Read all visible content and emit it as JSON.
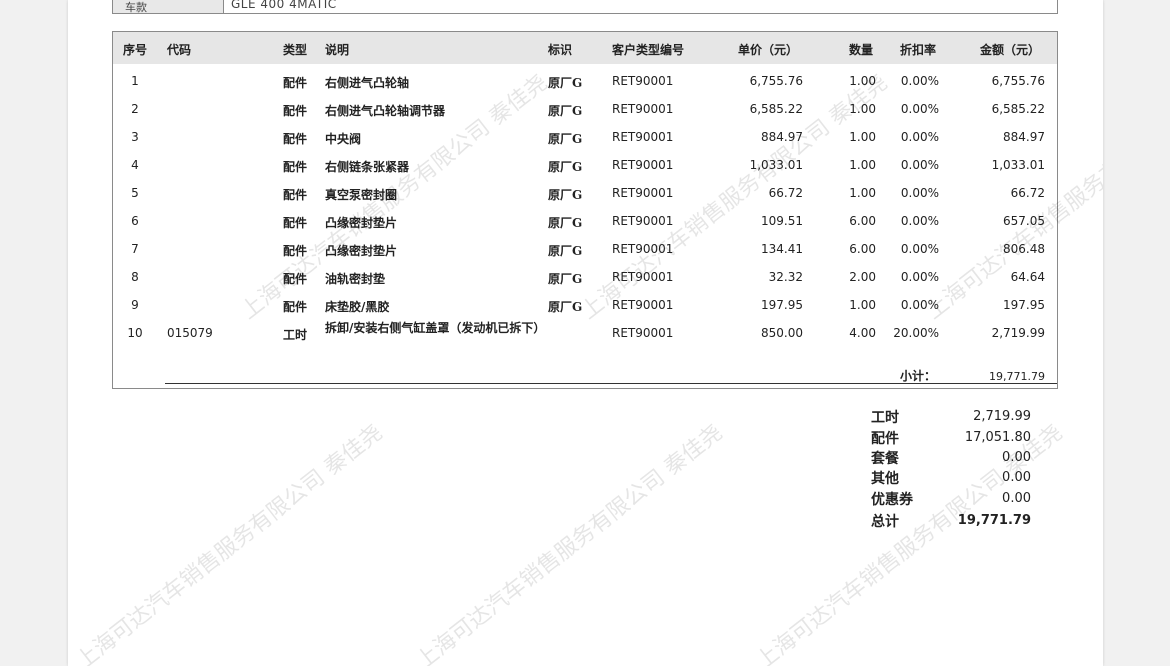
{
  "header_fragment": {
    "label": "车款",
    "value": "GLE 400 4MATIC"
  },
  "table": {
    "columns": [
      "序号",
      "代码",
      "类型",
      "说明",
      "标识",
      "客户类型编号",
      "单价（元）",
      "数量",
      "折扣率",
      "金额（元）"
    ],
    "rows": [
      {
        "no": "1",
        "code": "",
        "type": "配件",
        "desc": "右侧进气凸轮轴",
        "mark": "原厂G",
        "cust": "RET90001",
        "price": "6,755.76",
        "qty": "1.00",
        "disc": "0.00%",
        "amount": "6,755.76"
      },
      {
        "no": "2",
        "code": "",
        "type": "配件",
        "desc": "右侧进气凸轮轴调节器",
        "mark": "原厂G",
        "cust": "RET90001",
        "price": "6,585.22",
        "qty": "1.00",
        "disc": "0.00%",
        "amount": "6,585.22"
      },
      {
        "no": "3",
        "code": "",
        "type": "配件",
        "desc": "中央阀",
        "mark": "原厂G",
        "cust": "RET90001",
        "price": "884.97",
        "qty": "1.00",
        "disc": "0.00%",
        "amount": "884.97"
      },
      {
        "no": "4",
        "code": "",
        "type": "配件",
        "desc": "右侧链条张紧器",
        "mark": "原厂G",
        "cust": "RET90001",
        "price": "1,033.01",
        "qty": "1.00",
        "disc": "0.00%",
        "amount": "1,033.01"
      },
      {
        "no": "5",
        "code": "",
        "type": "配件",
        "desc": "真空泵密封圈",
        "mark": "原厂G",
        "cust": "RET90001",
        "price": "66.72",
        "qty": "1.00",
        "disc": "0.00%",
        "amount": "66.72"
      },
      {
        "no": "6",
        "code": "",
        "type": "配件",
        "desc": "凸缘密封垫片",
        "mark": "原厂G",
        "cust": "RET90001",
        "price": "109.51",
        "qty": "6.00",
        "disc": "0.00%",
        "amount": "657.05"
      },
      {
        "no": "7",
        "code": "",
        "type": "配件",
        "desc": "凸缘密封垫片",
        "mark": "原厂G",
        "cust": "RET90001",
        "price": "134.41",
        "qty": "6.00",
        "disc": "0.00%",
        "amount": "806.48"
      },
      {
        "no": "8",
        "code": "",
        "type": "配件",
        "desc": "油轨密封垫",
        "mark": "原厂G",
        "cust": "RET90001",
        "price": "32.32",
        "qty": "2.00",
        "disc": "0.00%",
        "amount": "64.64"
      },
      {
        "no": "9",
        "code": "",
        "type": "配件",
        "desc": "床垫胶/黑胶",
        "mark": "原厂G",
        "cust": "RET90001",
        "price": "197.95",
        "qty": "1.00",
        "disc": "0.00%",
        "amount": "197.95"
      },
      {
        "no": "10",
        "code": "015079",
        "type": "工时",
        "desc": "拆卸/安装右侧气缸盖罩（发动机已拆下）",
        "mark": "",
        "cust": "RET90001",
        "price": "850.00",
        "qty": "4.00",
        "disc": "20.00%",
        "amount": "2,719.99"
      }
    ],
    "subtotal_label": "小计：",
    "subtotal_value": "19,771.79"
  },
  "summary": {
    "labor_label": "工时",
    "labor_value": "2,719.99",
    "parts_label": "配件",
    "parts_value": "17,051.80",
    "package_label": "套餐",
    "package_value": "0.00",
    "other_label": "其他",
    "other_value": "0.00",
    "coupon_label": "优惠券",
    "coupon_value": "0.00",
    "total_label": "总计",
    "total_value": "19,771.79"
  },
  "watermark": {
    "text": "上海可达汽车销售服务有限公司 秦佳尧"
  }
}
